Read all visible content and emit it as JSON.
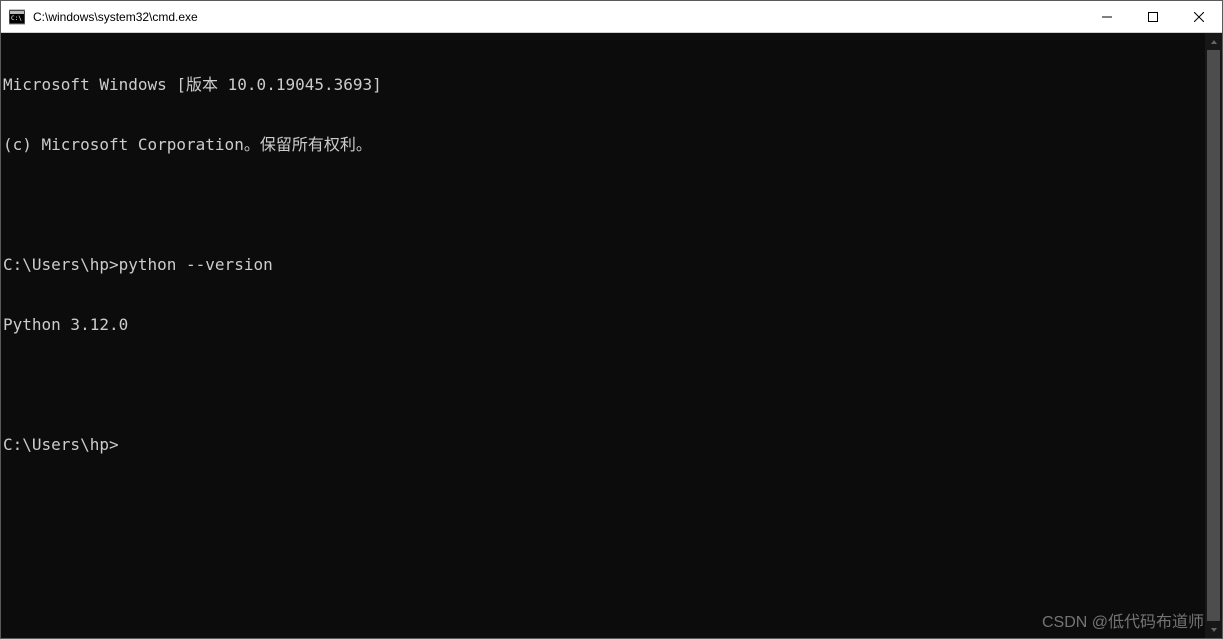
{
  "window": {
    "title": "C:\\windows\\system32\\cmd.exe"
  },
  "terminal": {
    "lines": [
      "Microsoft Windows [版本 10.0.19045.3693]",
      "(c) Microsoft Corporation。保留所有权利。",
      "",
      "C:\\Users\\hp>python --version",
      "Python 3.12.0",
      "",
      "C:\\Users\\hp>"
    ]
  },
  "watermark": "CSDN @低代码布道师"
}
